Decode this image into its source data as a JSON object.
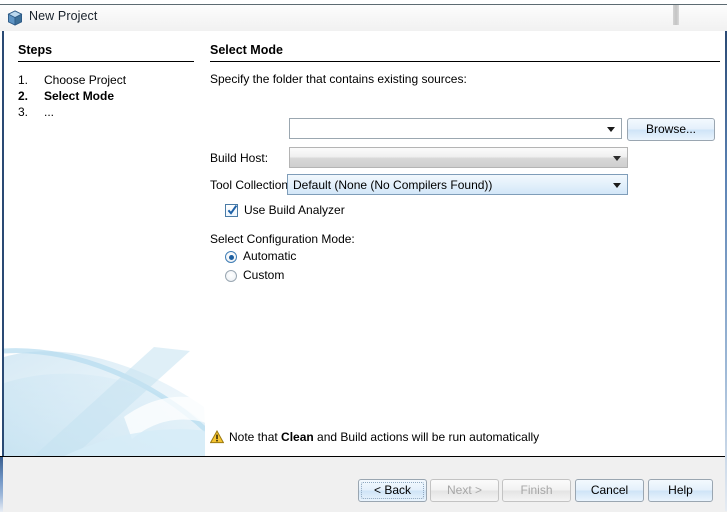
{
  "window": {
    "title": "New Project",
    "icon": "cube-icon"
  },
  "steps": {
    "heading": "Steps",
    "items": [
      {
        "number": "1.",
        "label": "Choose Project",
        "current": false
      },
      {
        "number": "2.",
        "label": "Select Mode",
        "current": true
      },
      {
        "number": "3.",
        "label": "...",
        "current": false
      }
    ]
  },
  "main": {
    "heading": "Select Mode",
    "folder": {
      "label": "Specify the folder that contains existing sources:",
      "value": "",
      "placeholder": "",
      "browse_label": "Browse..."
    },
    "build_host": {
      "label": "Build Host:",
      "value": "",
      "enabled": false
    },
    "tool_collection": {
      "label": "Tool Collection:",
      "value": "Default (None (No Compilers Found))"
    },
    "use_build_analyzer": {
      "label": "Use Build Analyzer",
      "checked": true
    },
    "config_mode": {
      "label": "Select Configuration Mode:",
      "options": [
        {
          "label": "Automatic",
          "selected": true
        },
        {
          "label": "Custom",
          "selected": false
        }
      ]
    },
    "note": {
      "icon": "warning-icon",
      "prefix": "Note that ",
      "emphasis": "Clean",
      "suffix": " and Build actions will be run automatically"
    }
  },
  "footer": {
    "buttons": [
      {
        "label": "< Back",
        "enabled": true,
        "focused": true
      },
      {
        "label": "Next >",
        "enabled": false,
        "focused": false
      },
      {
        "label": "Finish",
        "enabled": false,
        "focused": false
      },
      {
        "label": "Cancel",
        "enabled": true,
        "focused": false
      },
      {
        "label": "Help",
        "enabled": true,
        "focused": false
      }
    ]
  },
  "colors": {
    "accent_blue": "#2a4a74",
    "selection_blue": "#d3e7f8",
    "warning_yellow": "#e8b21a",
    "panel_gray": "#f0f0f0"
  }
}
